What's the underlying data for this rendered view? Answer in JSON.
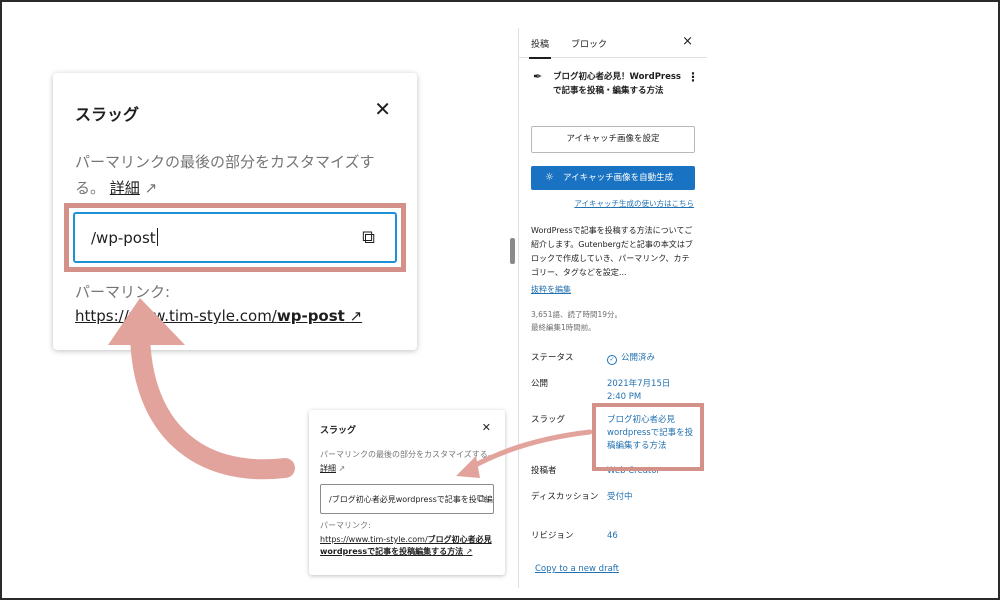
{
  "sidebar": {
    "tabs": [
      {
        "label": "投稿",
        "active": true
      },
      {
        "label": "ブロック",
        "active": false
      }
    ],
    "close_icon": "×",
    "post_title": "ブログ初心者必見！WordPressで記事を投稿・編集する方法",
    "set_featured_label": "アイキャッチ画像を設定",
    "auto_featured_label": "アイキャッチ画像を自動生成",
    "featured_help_link": "アイキャッチ生成の使い方はこちら",
    "excerpt": "WordPressで記事を投稿する方法についてご紹介します。Gutenbergだと記事の本文はブロックで作成していき、パーマリンク、カテゴリー、タグなどを設定...",
    "excerpt_edit": "抜粋を編集",
    "stats_words": "3,651語、読了時間19分。",
    "stats_edited": "最終編集1時間前。",
    "status_label": "ステータス",
    "status_value": "公開済み",
    "publish_label": "公開",
    "publish_date": "2021年7月15日",
    "publish_time": "2:40 PM",
    "slug_label": "スラッグ",
    "slug_value": "ブログ初心者必見wordpressで記事を投稿編集する方法",
    "author_label": "投稿者",
    "author_value": "Web Creator",
    "discussion_label": "ディスカッション",
    "discussion_value": "受付中",
    "revision_label": "リビジョン",
    "revision_value": "46",
    "draft_link": "Copy to a new draft"
  },
  "popup_large": {
    "title": "スラッグ",
    "desc": "パーマリンクの最後の部分をカスタマイズする。",
    "details_link": "詳細",
    "slug_value": "/wp-post",
    "permalink_label": "パーマリンク:",
    "permalink_base": "https://www.tim-style.com/",
    "permalink_slug": "wp-post"
  },
  "popup_small": {
    "title": "スラッグ",
    "desc": "パーマリンクの最後の部分をカスタマイズする。",
    "details_link": "詳細",
    "slug_value": "/ブログ初心者必見wordpressで記事を投稿編集する方法",
    "permalink_label": "パーマリンク:",
    "permalink_base": "https://www.tim-style.com/",
    "permalink_slug": "ブログ初心者必見wordpressで記事を投稿編集する方法"
  },
  "colors": {
    "highlight": "#d4918a",
    "accent": "#1a73c2",
    "link": "#2271b1"
  }
}
